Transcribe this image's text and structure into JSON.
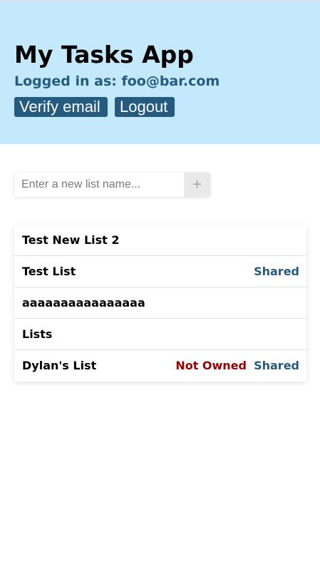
{
  "header": {
    "title": "My Tasks App",
    "logged_in": "Logged in as: foo@bar.com",
    "verify_label": "Verify email",
    "logout_label": "Logout"
  },
  "new_list": {
    "placeholder": "Enter a new list name...",
    "add_label": "+"
  },
  "lists": [
    {
      "name": "Test New List 2",
      "not_owned": "",
      "shared": ""
    },
    {
      "name": "Test List",
      "not_owned": "",
      "shared": "Shared"
    },
    {
      "name": "aaaaaaaaaaaaaaaa",
      "not_owned": "",
      "shared": ""
    },
    {
      "name": "Lists",
      "not_owned": "",
      "shared": ""
    },
    {
      "name": "Dylan's List",
      "not_owned": "Not Owned",
      "shared": "Shared"
    }
  ],
  "colors": {
    "header_bg": "#c4e9fc",
    "accent": "#245b7f",
    "not_owned": "#9b0000"
  }
}
